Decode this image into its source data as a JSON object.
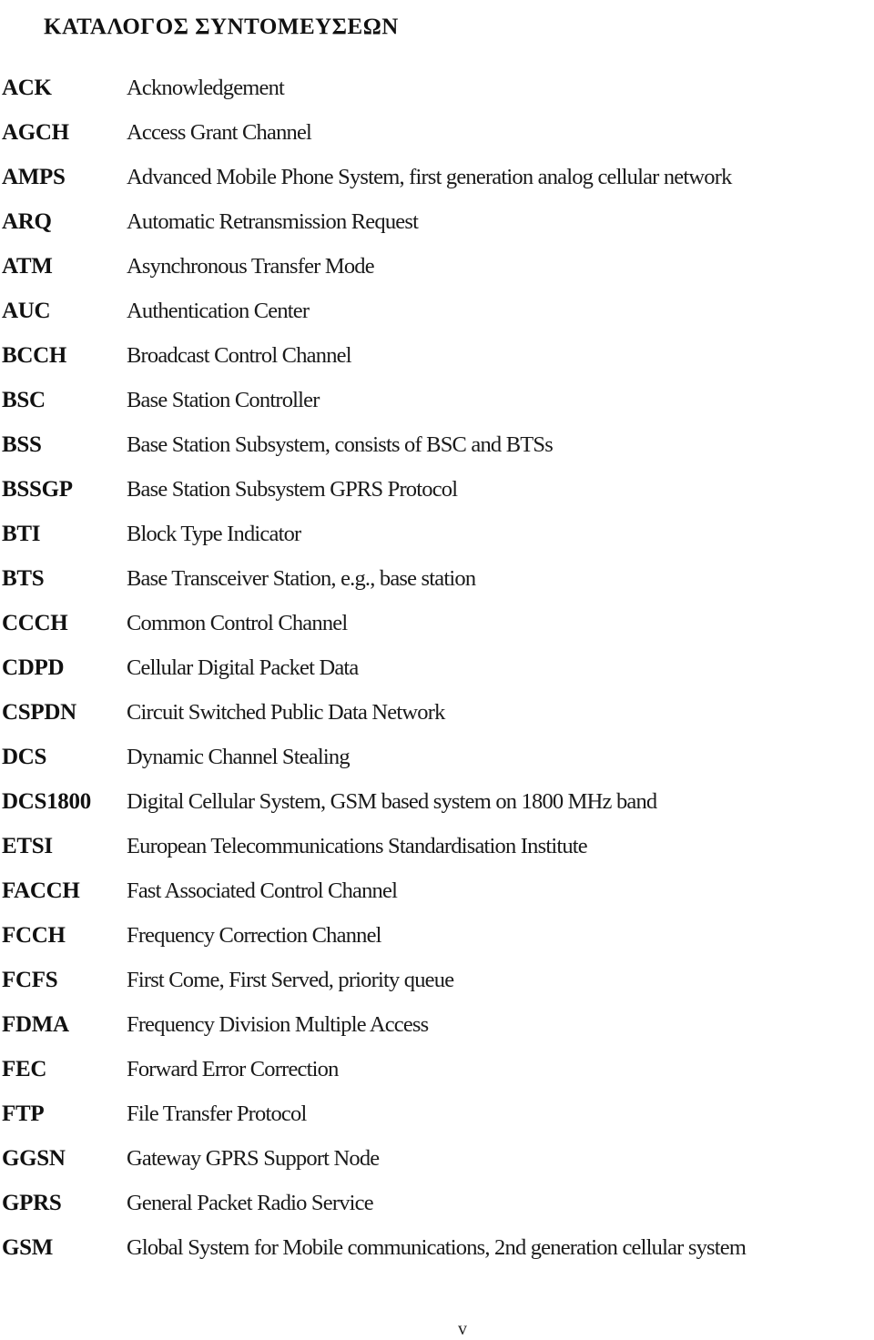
{
  "document": {
    "title": "ΚΑΤΑΛΟΓΟΣ ΣΥΝΤΟΜΕΥΣΕΩΝ",
    "page_number": "v",
    "abbreviations": [
      {
        "abbr": "ACK",
        "definition": "Acknowledgement"
      },
      {
        "abbr": "AGCH",
        "definition": "Access Grant Channel"
      },
      {
        "abbr": "AMPS",
        "definition": "Advanced Mobile Phone System, first generation analog cellular network"
      },
      {
        "abbr": "ARQ",
        "definition": "Automatic Retransmission Request"
      },
      {
        "abbr": "ATM",
        "definition": "Asynchronous Transfer Mode"
      },
      {
        "abbr": "AUC",
        "definition": "Authentication Center"
      },
      {
        "abbr": "BCCH",
        "definition": "Broadcast Control Channel"
      },
      {
        "abbr": "BSC",
        "definition": "Base Station Controller"
      },
      {
        "abbr": "BSS",
        "definition": "Base Station Subsystem, consists of BSC and BTSs"
      },
      {
        "abbr": "BSSGP",
        "definition": "Base Station Subsystem GPRS Protocol"
      },
      {
        "abbr": "BTI",
        "definition": "Block Type Indicator"
      },
      {
        "abbr": "BTS",
        "definition": "Base Transceiver Station, e.g., base station"
      },
      {
        "abbr": "CCCH",
        "definition": "Common Control Channel"
      },
      {
        "abbr": "CDPD",
        "definition": "Cellular Digital Packet Data"
      },
      {
        "abbr": "CSPDN",
        "definition": "Circuit Switched Public Data Network"
      },
      {
        "abbr": "DCS",
        "definition": "Dynamic Channel Stealing"
      },
      {
        "abbr": "DCS1800",
        "definition": "Digital Cellular System, GSM based system on 1800 MHz band"
      },
      {
        "abbr": "ETSI",
        "definition": "European Telecommunications Standardisation Institute"
      },
      {
        "abbr": "FACCH",
        "definition": "Fast Associated Control Channel"
      },
      {
        "abbr": "FCCH",
        "definition": "Frequency Correction Channel"
      },
      {
        "abbr": "FCFS",
        "definition": "First Come, First Served, priority queue"
      },
      {
        "abbr": "FDMA",
        "definition": "Frequency Division Multiple Access"
      },
      {
        "abbr": "FEC",
        "definition": "Forward Error Correction"
      },
      {
        "abbr": "FTP",
        "definition": "File Transfer Protocol"
      },
      {
        "abbr": "GGSN",
        "definition": "Gateway GPRS Support Node"
      },
      {
        "abbr": "GPRS",
        "definition": "General Packet Radio Service"
      },
      {
        "abbr": "GSM",
        "definition": "Global System for Mobile communications, 2nd generation cellular system"
      }
    ]
  }
}
